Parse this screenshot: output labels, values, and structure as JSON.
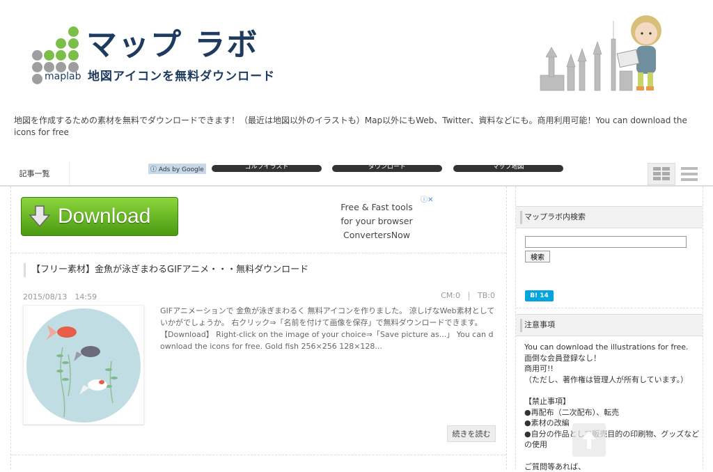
{
  "header": {
    "logo_title": "マップ ラボ",
    "logo_subtitle": "地図アイコンを無料ダウンロード",
    "logo_wordmark": "maplab",
    "tagline": "地図を作成するための素材を無料でダウンロードできます！（最近は地図以外のイラストも）Map以外にもWeb、Twitter、資料などにも。商用利用可能！You can download the icons for free"
  },
  "nav": {
    "articles_label": "記事一覧",
    "ads_label": "ⓘ Ads by Google",
    "pills": [
      "ゴルフイラスト",
      "ダウンロード",
      "マップ地図"
    ],
    "icons": [
      "grid-view-icon",
      "list-view-icon"
    ]
  },
  "ad": {
    "download_label": "Download",
    "line1": "Free & Fast tools",
    "line2": "for your browser",
    "line3": "ConvertersNow",
    "close_glyph": "ⓘ✕"
  },
  "post": {
    "title": "【フリー素材】金魚が泳ぎまわるGIFアニメ・・・無料ダウンロード",
    "date": "2015/08/13　14:59",
    "cm": "CM:0",
    "tb": "TB:0",
    "excerpt": "GIFアニメーションで 金魚が泳ぎまわるく 無料アイコンを作りました。 涼しげなWeb素材としていかがでしょうか。 右クリック⇒「名前を付けて画像を保存」で無料ダウンロードできます。 【Download】 Right-click on the image of your choice⇒「Save picture as...」 You can download the icons for free. Gold fish 256×256 128×128...",
    "more_label": "続きを読む"
  },
  "sidebar": {
    "search_heading": "マップラボ内検索",
    "search_button": "検索",
    "hatena_label": "B! 14",
    "notice_heading": "注意事項",
    "notice_lines": [
      "You can download the illustrations for free.",
      "面倒な会員登録なし！",
      "商用可!!",
      "（ただし、著作権は管理人が所有しています。）",
      "",
      "【禁止事項】",
      "●再配布（二次配布）、転売",
      "●素材の改編",
      "●自分の作品として販売目的の印刷物、グッズなど",
      "の使用",
      "",
      "ご質問等あれば、"
    ]
  },
  "colors": {
    "brand_navy": "#1e3a5f",
    "dot_green": "#7bbf4a",
    "dot_gray": "#9e9e9e",
    "download_green": "#6cbd2a"
  }
}
